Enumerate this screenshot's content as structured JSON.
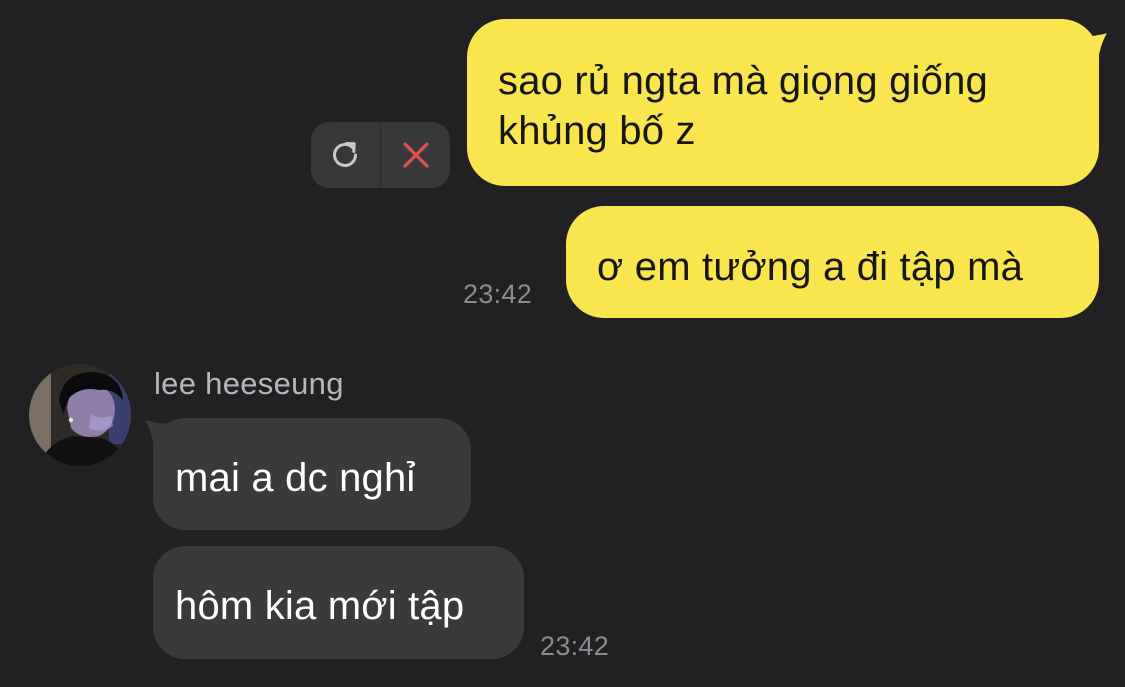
{
  "conversation": {
    "outgoing": [
      {
        "text": "sao rủ ngta mà giọng giống khủng bố z"
      },
      {
        "text": "ơ em tưởng a đi tập mà"
      }
    ],
    "outgoing_time": "23:42",
    "incoming": {
      "sender": "lee heeseung",
      "messages": [
        {
          "text": "mai a dc nghỉ"
        },
        {
          "text": "hôm kia mới tập"
        }
      ],
      "time": "23:42"
    }
  },
  "failed_message_actions": {
    "retry_icon": "refresh-icon",
    "delete_icon": "close-icon"
  },
  "colors": {
    "background": "#212124",
    "outgoing_bubble": "#f9e54e",
    "incoming_bubble": "#3a3a3d",
    "delete_x": "#e0524b"
  }
}
